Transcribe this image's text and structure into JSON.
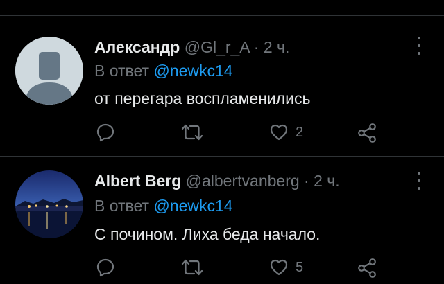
{
  "tweets": [
    {
      "display_name": "Александр",
      "handle": "@Gl_r_A",
      "separator": "·",
      "time": "2 ч.",
      "reply_prefix": "В ответ",
      "reply_to": "@newkc14",
      "text": "от перегара воспламенились",
      "likes": "2",
      "avatar_icon": "default-profile-icon"
    },
    {
      "display_name": "Albert Berg",
      "handle": "@albertvanberg",
      "separator": "·",
      "time": "2 ч.",
      "reply_prefix": "В ответ",
      "reply_to": "@newkc14",
      "text": "С почином. Лиха беда начало.",
      "likes": "5",
      "avatar_icon": "night-harbor-photo"
    }
  ],
  "icons": {
    "reply": "reply-icon",
    "retweet": "retweet-icon",
    "like": "heart-icon",
    "share": "share-icon",
    "more": "more-options-icon"
  },
  "colors": {
    "background": "#000000",
    "text": "#e7e9ea",
    "muted": "#71767b",
    "link": "#1d9bf0",
    "divider": "#2f3336"
  }
}
